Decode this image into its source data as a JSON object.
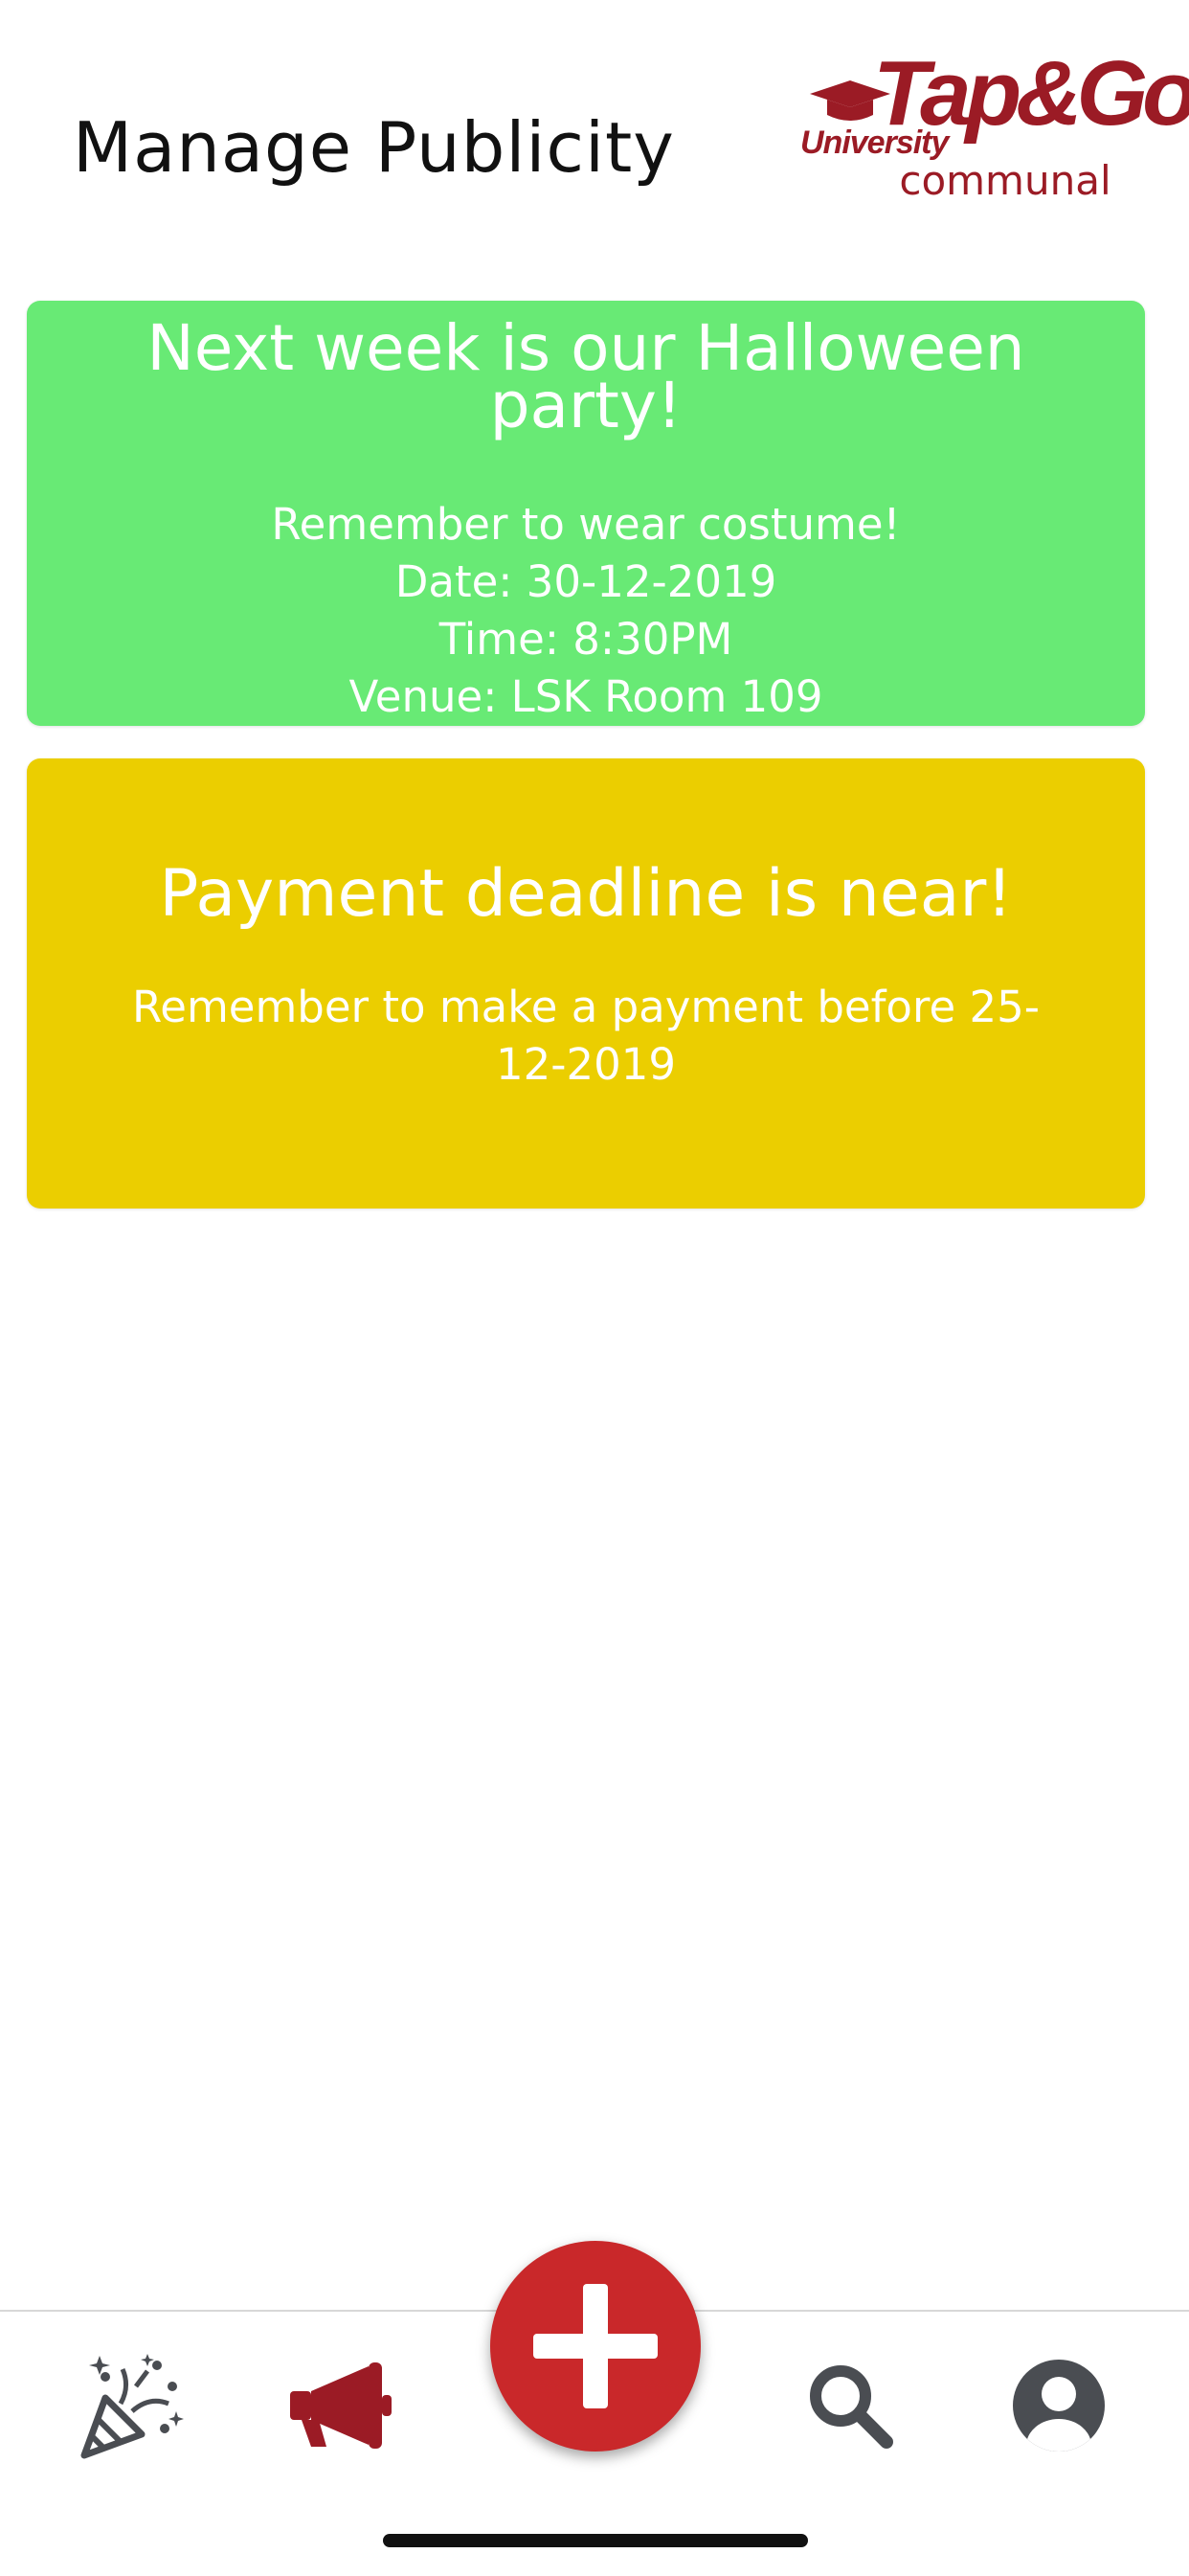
{
  "header": {
    "title": "Manage Publicity",
    "logo": {
      "brand": "Tap&Go",
      "university": "University",
      "subtitle": "communal"
    }
  },
  "posts": [
    {
      "title": "Next week is our Halloween party!",
      "lines": [
        "Remember to wear costume!",
        "Date: 30-12-2019",
        "Time: 8:30PM",
        "Venue: LSK Room 109"
      ],
      "color": "#68ea75"
    },
    {
      "title": "Payment deadline is near!",
      "lines": [
        "Remember to make a payment before 25-12-2019"
      ],
      "color": "#ebce00"
    }
  ],
  "tabbar": {
    "items": [
      {
        "icon": "party-popper-icon",
        "active": false
      },
      {
        "icon": "megaphone-icon",
        "active": true
      },
      {
        "icon": "plus-icon",
        "primary": true
      },
      {
        "icon": "search-icon",
        "active": false
      },
      {
        "icon": "user-profile-icon",
        "active": false
      }
    ]
  },
  "colors": {
    "brand": "#9b1b25",
    "fab": "#c9282a",
    "icon_inactive": "#4a4d52"
  }
}
